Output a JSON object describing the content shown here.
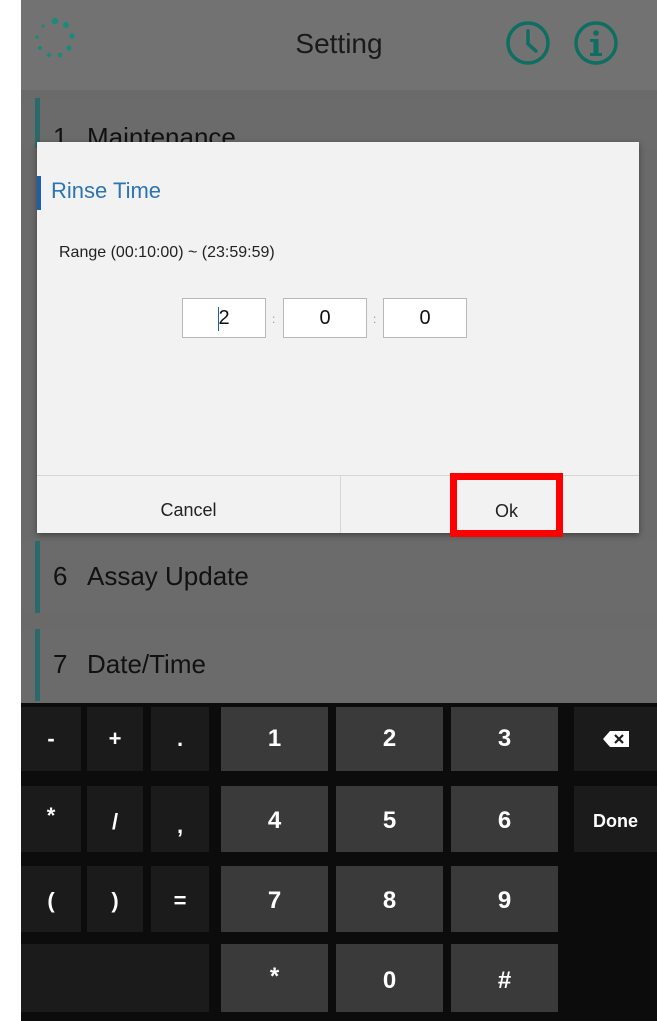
{
  "header": {
    "title": "Setting",
    "logo_icon": "spinner-dots-icon",
    "clock_icon": "clock-icon",
    "info_icon": "info-icon",
    "accent_color": "#0e6e62"
  },
  "menu": {
    "items": [
      {
        "number": "1",
        "label": "Maintenance"
      },
      {
        "number": "6",
        "label": "Assay Update"
      },
      {
        "number": "7",
        "label": "Date/Time"
      }
    ]
  },
  "dialog": {
    "title": "Rinse Time",
    "range": "Range (00:10:00) ~ (23:59:59)",
    "hours": "2",
    "minutes": "0",
    "seconds": "0",
    "separator": ":",
    "cancel_label": "Cancel",
    "ok_label": "Ok"
  },
  "keyboard": {
    "row1": [
      "-",
      "+",
      ".",
      "1",
      "2",
      "3"
    ],
    "row2": [
      "*",
      "/",
      ",",
      "4",
      "5",
      "6"
    ],
    "row3": [
      "(",
      ")",
      "=",
      "7",
      "8",
      "9"
    ],
    "row4": [
      "*",
      "0",
      "#"
    ],
    "done_label": "Done",
    "backspace_icon": "backspace-icon"
  }
}
